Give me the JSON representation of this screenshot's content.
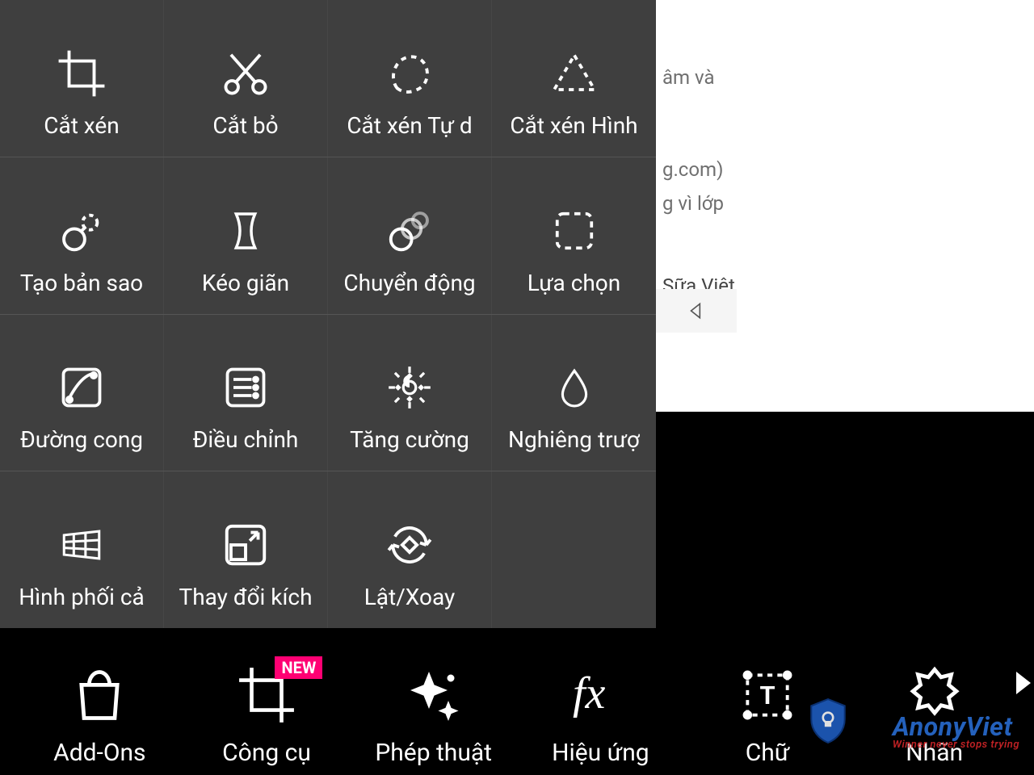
{
  "background": {
    "text1": "âm và",
    "text2": "g.com)",
    "text3": "g vì lớp",
    "text4": "Sữa Việt"
  },
  "tool_panel": {
    "rows": [
      [
        {
          "icon": "crop",
          "label": "Cắt xén"
        },
        {
          "icon": "cut",
          "label": "Cắt bỏ"
        },
        {
          "icon": "freeform",
          "label": "Cắt xén Tự d"
        },
        {
          "icon": "shape-crop",
          "label": "Cắt xén Hình"
        }
      ],
      [
        {
          "icon": "clone",
          "label": "Tạo bản sao"
        },
        {
          "icon": "stretch",
          "label": "Kéo giãn"
        },
        {
          "icon": "motion",
          "label": "Chuyển động"
        },
        {
          "icon": "select",
          "label": "Lựa chọn"
        }
      ],
      [
        {
          "icon": "curves",
          "label": "Đường cong"
        },
        {
          "icon": "adjust",
          "label": "Điều chỉnh"
        },
        {
          "icon": "enhance",
          "label": "Tăng cường"
        },
        {
          "icon": "tilt",
          "label": "Nghiêng trượ"
        }
      ],
      [
        {
          "icon": "perspective",
          "label": "Hình phối cả"
        },
        {
          "icon": "resize",
          "label": "Thay đổi kích"
        },
        {
          "icon": "flip",
          "label": "Lật/Xoay"
        }
      ]
    ]
  },
  "bottom_bar": {
    "items": [
      {
        "icon": "bag",
        "label": "Add-Ons",
        "badge": null
      },
      {
        "icon": "crop",
        "label": "Công cụ",
        "badge": "NEW"
      },
      {
        "icon": "sparkle",
        "label": "Phép thuật",
        "badge": null
      },
      {
        "icon": "fx",
        "label": "Hiệu ứng",
        "badge": null
      },
      {
        "icon": "text",
        "label": "Chữ",
        "badge": null
      },
      {
        "icon": "sticker",
        "label": "Nhãn",
        "badge": null
      }
    ]
  },
  "watermark": {
    "brand": "AnonyViet",
    "tagline": "Winner never stops trying"
  }
}
